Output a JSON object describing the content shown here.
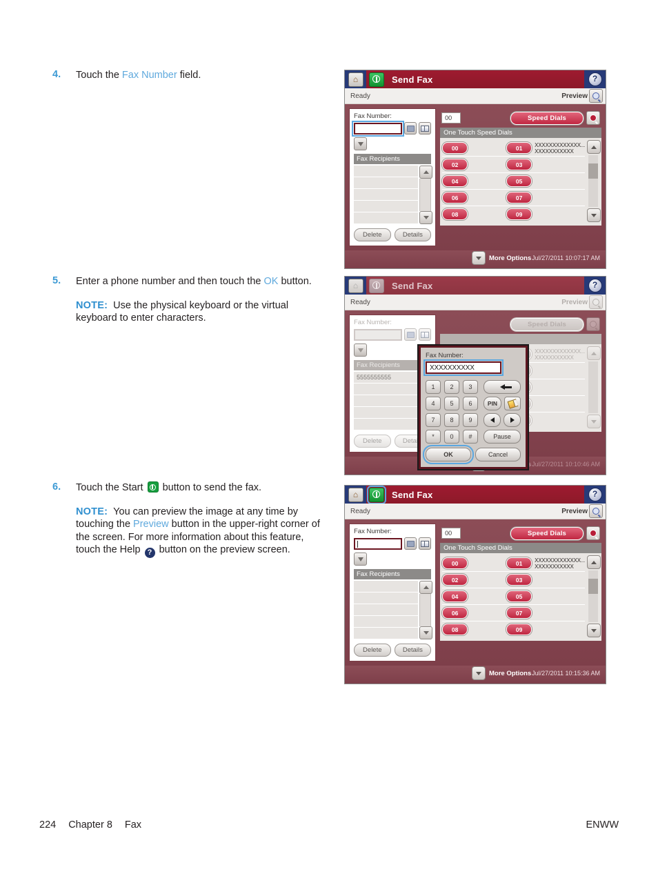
{
  "page": {
    "footer_page_number": "224",
    "footer_chapter": "Chapter 8",
    "footer_section": "Fax",
    "footer_right": "ENWW"
  },
  "steps": [
    {
      "number": "4.",
      "text_before": "Touch the ",
      "link": "Fax Number",
      "text_after": " field."
    },
    {
      "number": "5.",
      "text_before": "Enter a phone number and then touch the ",
      "link": "OK",
      "text_after": " button.",
      "note_label": "NOTE:",
      "note_text": "Use the physical keyboard or the virtual keyboard to enter characters."
    },
    {
      "number": "6.",
      "text_before": "Touch the Start ",
      "icon": "start-icon",
      "text_after": " button to send the fax.",
      "note_label": "NOTE:",
      "note_part1": "You can preview the image at any time by touching the ",
      "note_link": "Preview",
      "note_part2": " button in the upper-right corner of the screen. For more information about this feature, touch the Help ",
      "note_icon": "help-icon",
      "note_part3": " button on the preview screen."
    }
  ],
  "panel1": {
    "title": "Send Fax",
    "status": "Ready",
    "preview_label": "Preview",
    "fax_number_label": "Fax Number:",
    "fax_number_value": "",
    "fax_recipients_label": "Fax Recipients",
    "recipients": [
      "",
      "",
      "",
      "",
      ""
    ],
    "delete_label": "Delete",
    "details_label": "Details",
    "speed_dial_index": "00",
    "speed_dials_label": "Speed Dials",
    "one_touch_label": "One Touch Speed Dials",
    "one_touch": [
      {
        "left": "00",
        "right": "01",
        "label_line1": "XXXXXXXXXXXXX...",
        "label_line2": "XXXXXXXXXXX"
      },
      {
        "left": "02",
        "right": "03",
        "label_line1": "",
        "label_line2": ""
      },
      {
        "left": "04",
        "right": "05",
        "label_line1": "",
        "label_line2": ""
      },
      {
        "left": "06",
        "right": "07",
        "label_line1": "",
        "label_line2": ""
      },
      {
        "left": "08",
        "right": "09",
        "label_line1": "",
        "label_line2": ""
      }
    ],
    "more_options_label": "More Options",
    "timestamp": "Jul/27/2011 10:07:17 AM"
  },
  "panel2": {
    "title": "Send Fax",
    "status": "Ready",
    "preview_label": "Preview",
    "fax_number_label": "Fax Number:",
    "fax_recipients_label": "Fax Recipients",
    "recipients": [
      "5555555555",
      "",
      "",
      "",
      ""
    ],
    "delete_label": "Delete",
    "details_label": "Details",
    "speed_dials_label": "Speed Dials",
    "more_options_label": "More Options",
    "timestamp": "Jul/27/2011 10:10:46 AM",
    "dialog": {
      "label": "Fax Number:",
      "value": "XXXXXXXXXX",
      "keys": [
        "1",
        "2",
        "3",
        "4",
        "5",
        "6",
        "7",
        "8",
        "9",
        "*",
        "0",
        "#"
      ],
      "backspace_icon": "backspace-icon",
      "pin_label": "PIN",
      "eraser_icon": "eraser-icon",
      "left_arrow_icon": "arrow-left-icon",
      "right_arrow_icon": "arrow-right-icon",
      "pause_label": "Pause",
      "ok_label": "OK",
      "cancel_label": "Cancel"
    }
  },
  "panel3": {
    "title": "Send Fax",
    "status": "Ready",
    "preview_label": "Preview",
    "fax_number_label": "Fax Number:",
    "fax_number_value": "",
    "fax_recipients_label": "Fax Recipients",
    "recipients": [
      "",
      "",
      "",
      "",
      ""
    ],
    "delete_label": "Delete",
    "details_label": "Details",
    "speed_dial_index": "00",
    "speed_dials_label": "Speed Dials",
    "one_touch_label": "One Touch Speed Dials",
    "one_touch": [
      {
        "left": "00",
        "right": "01",
        "label_line1": "XXXXXXXXXXXXX...",
        "label_line2": "XXXXXXXXXXX"
      },
      {
        "left": "02",
        "right": "03",
        "label_line1": "",
        "label_line2": ""
      },
      {
        "left": "04",
        "right": "05",
        "label_line1": "",
        "label_line2": ""
      },
      {
        "left": "06",
        "right": "07",
        "label_line1": "",
        "label_line2": ""
      },
      {
        "left": "08",
        "right": "09",
        "label_line1": "",
        "label_line2": ""
      }
    ],
    "more_options_label": "More Options",
    "timestamp": "Jul/27/2011 10:15:36 AM"
  },
  "colors": {
    "accent_link": "#5fa9dd",
    "note_blue": "#2f8fcf",
    "header_red": "#9e1b30",
    "panel_body": "#8c4d57",
    "pill_red": "#bf2640",
    "home_navy": "#273a78",
    "start_green": "#12912f",
    "selection_blue": "#5ba7e0"
  }
}
